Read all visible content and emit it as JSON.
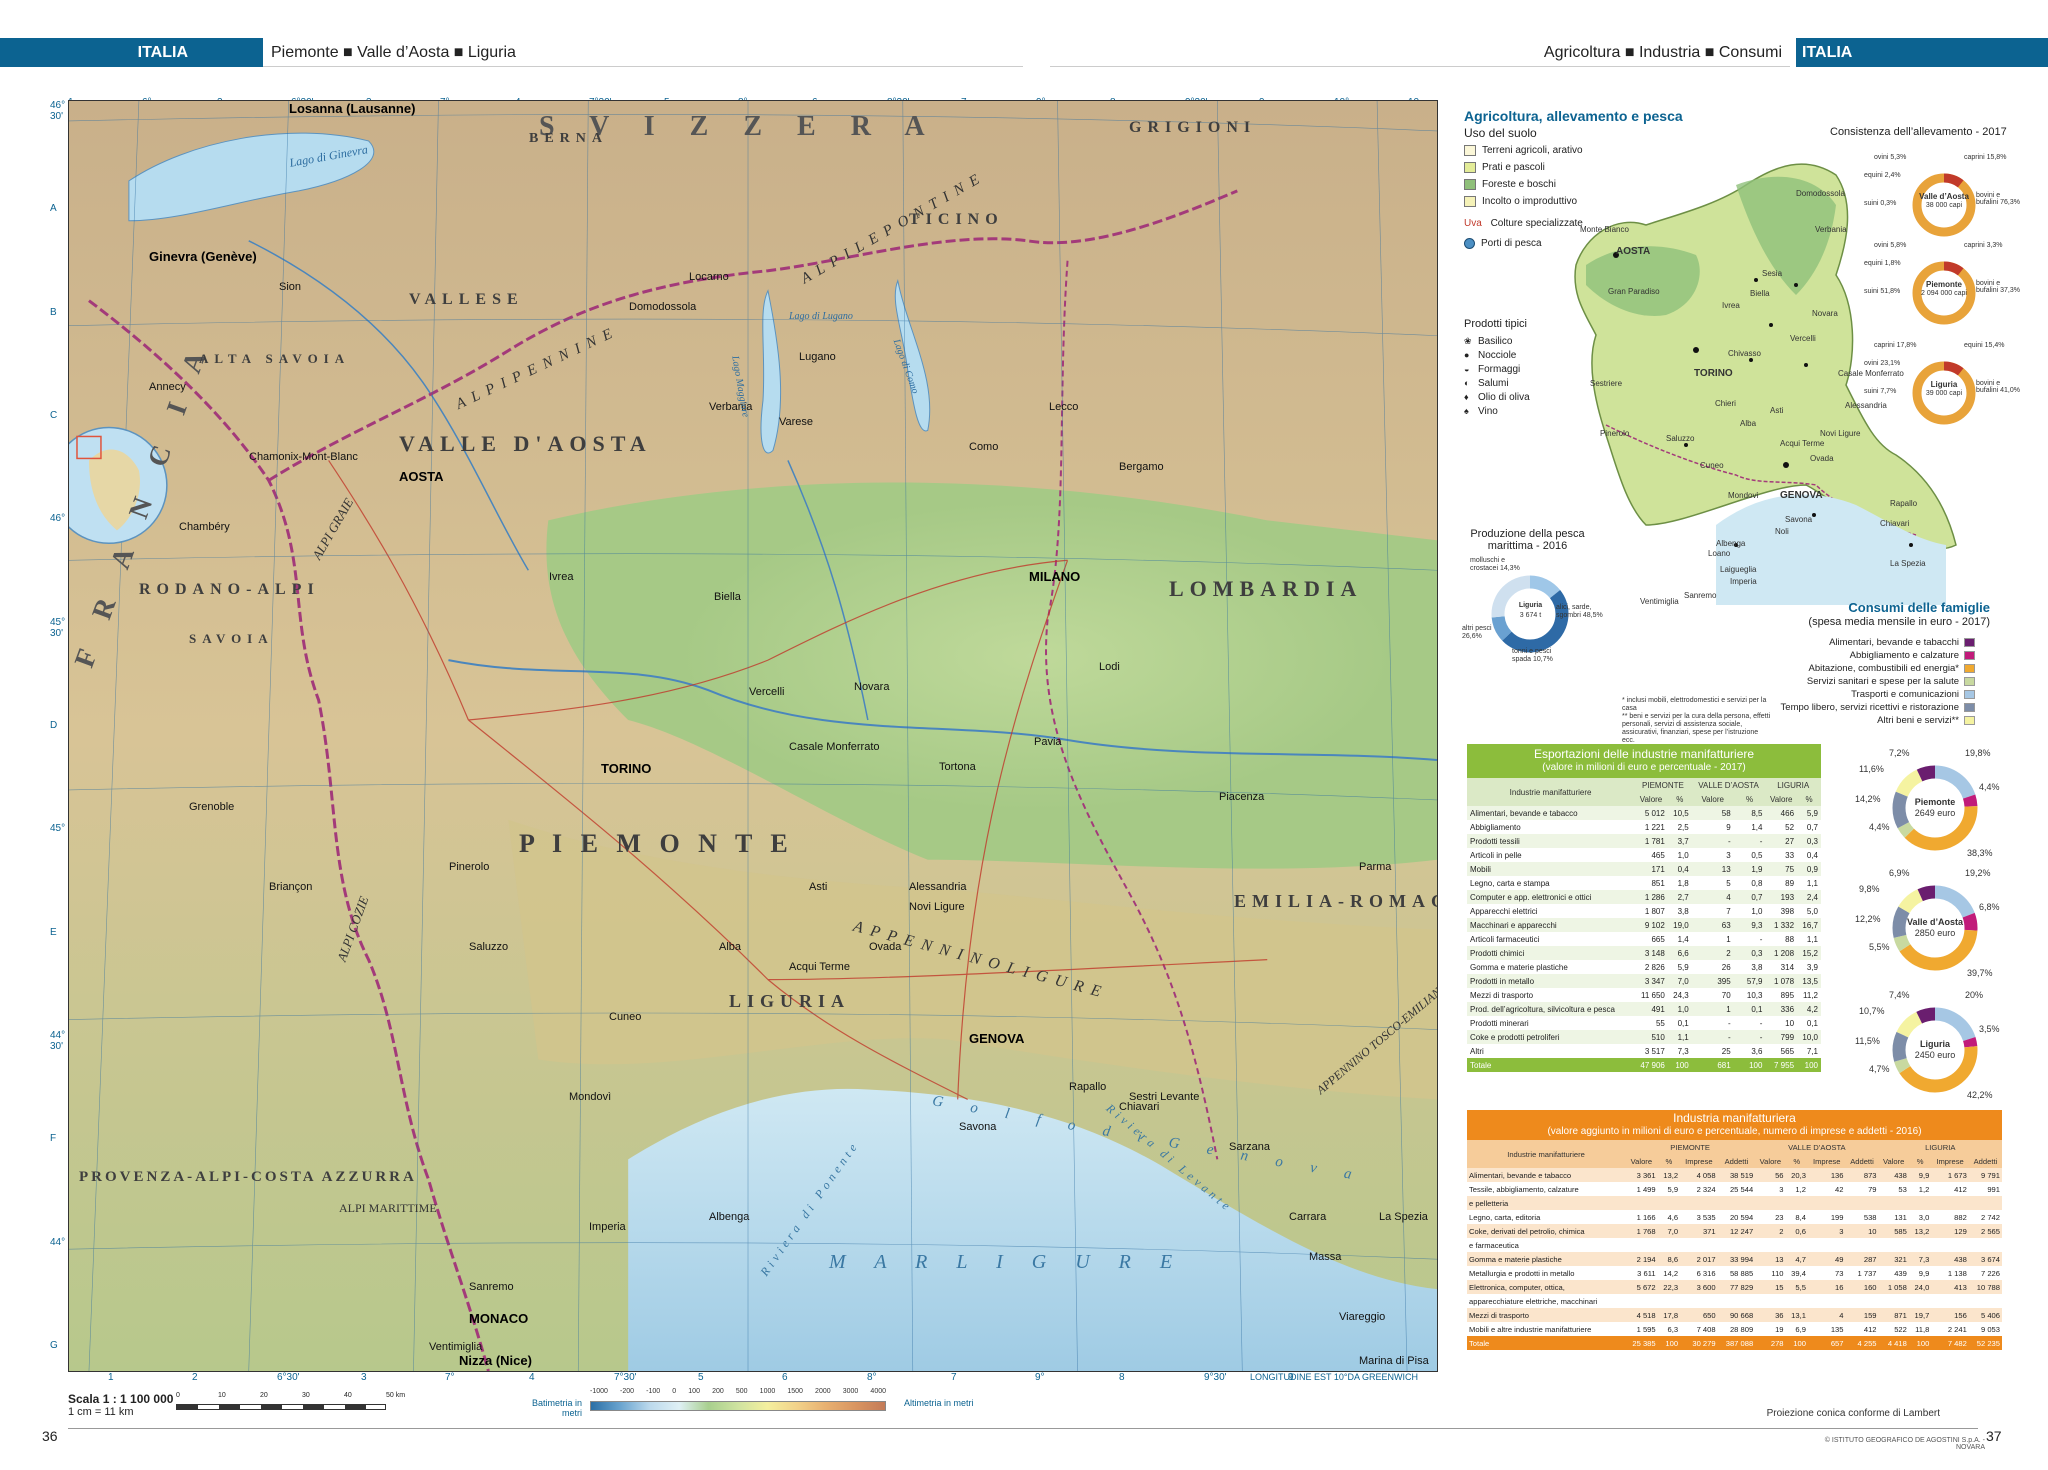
{
  "header": {
    "left_title": "ITALIA",
    "left_sub": "Piemonte ■ Valle d’Aosta ■ Liguria",
    "right_sub": "Agricoltura ■ Industria ■ Consumi",
    "right_title": "ITALIA"
  },
  "map": {
    "grid_top": [
      "1",
      "6°",
      "2",
      "6°30'",
      "3",
      "7°",
      "4",
      "7°30'",
      "5",
      "8°",
      "6",
      "8°30'",
      "7",
      "9°",
      "8",
      "9°30'",
      "9",
      "10°",
      "10"
    ],
    "grid_bottom": [
      "1",
      "2",
      "6°30'",
      "3",
      "7°",
      "4",
      "7°30'",
      "5",
      "6",
      "8°",
      "7",
      "9°",
      "8",
      "9°30'",
      "9"
    ],
    "grid_left": [
      "46° 30'",
      "A",
      "B",
      "C",
      "46°",
      "45° 30'",
      "D",
      "45°",
      "E",
      "44° 30'",
      "F",
      "44°",
      "G"
    ],
    "countries": [
      "S V I Z Z E R A",
      "F R A N C I A"
    ],
    "regions": [
      "VALLE D'AOSTA",
      "P I E M O N T E",
      "LOMBARDIA",
      "EMILIA-ROMAGNA",
      "LIGURIA",
      "RODANO-ALPI",
      "PROVENZA-ALPI-COSTA AZZURRA",
      "VALLESE",
      "TICINO",
      "GRIGIONI",
      "BERNA",
      "SAVOIA",
      "ALTA SAVOIA"
    ],
    "mountains": [
      "A L P I   P E N N I N E",
      "A L P I   L E P O N T I N E",
      "A P P E N N I N O   L I G U R E",
      "ALPI MARITTIME",
      "ALPI GRAIE",
      "ALPI COZIE",
      "APPENNINO TOSCO-EMILIANO"
    ],
    "sea": [
      "M A R   L I G U R E",
      "G o l f o   d i   G e n o v a",
      "Riviera di Ponente",
      "Riviera di Levante"
    ],
    "big_cities": [
      "TORINO",
      "MILANO",
      "GENOVA",
      "AOSTA",
      "Ginevra (Genève)",
      "Losanna (Lausanne)",
      "Nizza (Nice)",
      "MONACO"
    ],
    "cities": [
      "Novara",
      "Vercelli",
      "Biella",
      "Asti",
      "Alessandria",
      "Cuneo",
      "Savona",
      "La Spezia",
      "Imperia",
      "Pavia",
      "Varese",
      "Como",
      "Lecco",
      "Bergamo",
      "Lodi",
      "Piacenza",
      "Parma",
      "Sion",
      "Locarno",
      "Lugano",
      "Chiavari",
      "Sanremo",
      "Ventimiglia",
      "Chambéry",
      "Annecy",
      "Grenoble",
      "Briançon",
      "Chamonix-Mont-Blanc",
      "Domodossola",
      "Verbania",
      "Ivrea",
      "Pinerolo",
      "Saluzzo",
      "Mondovì",
      "Alba",
      "Casale Monferrato",
      "Tortona",
      "Novi Ligure",
      "Ovada",
      "Acqui Terme",
      "Rapallo",
      "Sestri Levante",
      "Albenga",
      "Sarzana",
      "Carrara",
      "Massa",
      "Viareggio"
    ],
    "lakes": [
      "Lago di Ginevra",
      "Lago Maggiore",
      "Lago di Como",
      "Lago di Lugano"
    ],
    "scale": {
      "label": "Scala 1 : 1 100 000",
      "sub": "1 cm = 11 km",
      "ticks": [
        "0",
        "10",
        "20",
        "30",
        "40",
        "50 km"
      ]
    },
    "bathy_label": "Batimetria in metri",
    "alti_label": "Altimetria in metri",
    "elev_ticks": [
      "-1000",
      "-200",
      "-100",
      "0",
      "100",
      "200",
      "500",
      "1000",
      "1500",
      "2000",
      "3000",
      "4000"
    ],
    "longitude_note": "LONGITUDINE EST 10°DA GREENWICH",
    "marina": "Marina di Pisa"
  },
  "agricoltura": {
    "title": "Agricoltura, allevamento e pesca",
    "uso_title": "Uso del suolo",
    "uso": [
      {
        "label": "Terreni agricoli, arativo",
        "color": "#fbf7d8"
      },
      {
        "label": "Prati e pascoli",
        "color": "#e3ec98"
      },
      {
        "label": "Foreste e boschi",
        "color": "#8fc07a"
      },
      {
        "label": "Incolto o improduttivo",
        "color": "#f5f2b8"
      }
    ],
    "uva": "Uva",
    "uva_label": "Colture specializzate",
    "porti": "Porti di pesca",
    "prodotti_title": "Prodotti tipici",
    "prodotti": [
      "Basilico",
      "Nocciole",
      "Formaggi",
      "Salumi",
      "Olio di oliva",
      "Vino"
    ],
    "alleva_title": "Consistenza dell’allevamento - 2017",
    "region_labels": [
      "AOSTA",
      "TORINO",
      "GENOVA",
      "Biella",
      "Novara",
      "Vercelli",
      "Asti",
      "Alessandria",
      "Cuneo",
      "Savona",
      "Imperia",
      "La Spezia",
      "Verbania",
      "Chivasso",
      "Mondovì",
      "Sanremo",
      "Ventimiglia",
      "Chiavari",
      "Rapallo",
      "Noli",
      "Albenga",
      "Laigueglia",
      "Loano",
      "Pinerolo",
      "Saluzzo",
      "Sestriere",
      "Ivrea",
      "Domodossola",
      "Alba",
      "Ovada",
      "Acqui Terme",
      "Novi Ligure",
      "Casale Monferrato",
      "Chieri",
      "Sesia",
      "Monte Bianco",
      "Gran Paradiso"
    ],
    "alleva_donuts": [
      {
        "name": "Valle d’Aosta",
        "value": "38 000 capi",
        "labels": [
          "ovini 5,3%",
          "caprini 15,8%",
          "equini 2,4%",
          "suini 0,3%",
          "bovini e bufalini 76,3%"
        ]
      },
      {
        "name": "Piemonte",
        "value": "2 094 000 capi",
        "labels": [
          "ovini 5,8%",
          "caprini 3,3%",
          "equini 1,8%",
          "suini 51,8%",
          "bovini e bufalini 37,3%"
        ]
      },
      {
        "name": "Liguria",
        "value": "39 000 capi",
        "labels": [
          "caprini 17,8%",
          "equini 15,4%",
          "ovini 23,1%",
          "suini 7,7%",
          "bovini e bufalini 41,0%"
        ]
      }
    ]
  },
  "pesca": {
    "title": "Produzione della pesca marittima - 2016",
    "center_name": "Liguria",
    "center_value": "3 674 t",
    "labels": [
      "molluschi e crostacei 14,3%",
      "alici, sarde, sgombri 48,5%",
      "tonni e pesci spada 10,7%",
      "altri pesci 26,6%"
    ],
    "values": [
      14.3,
      48.5,
      10.7,
      26.6
    ]
  },
  "consumi": {
    "title": "Consumi delle famiglie",
    "sub": "(spesa media mensile in euro - 2017)",
    "legend": [
      {
        "label": "Alimentari, bevande e tabacchi",
        "color": "#6a1e6f"
      },
      {
        "label": "Abbigliamento e calzature",
        "color": "#c11b7a"
      },
      {
        "label": "Abitazione, combustibili ed energia*",
        "color": "#f0a930"
      },
      {
        "label": "Servizi sanitari e spese per la salute",
        "color": "#c8d9a0"
      },
      {
        "label": "Trasporti e comunicazioni",
        "color": "#a6c7e4"
      },
      {
        "label": "Tempo libero, servizi ricettivi e ristorazione",
        "color": "#7d8da8"
      },
      {
        "label": "Altri beni e servizi**",
        "color": "#f5f3a1"
      }
    ],
    "notes": [
      "* inclusi mobili, elettrodomestici e servizi per la casa",
      "** beni e servizi per la cura della persona, effetti personali, servizi di assistenza sociale, assicurativi, finanziari, spese per l’istruzione ecc."
    ],
    "donuts": [
      {
        "name": "Piemonte",
        "value": "2649 euro",
        "pcts": [
          "7,2%",
          "19,8%",
          "11,6%",
          "4,4%",
          "14,2%",
          "4,4%",
          "38,3%"
        ],
        "values": [
          19.8,
          4.4,
          38.3,
          4.4,
          14.2,
          11.6,
          7.2
        ]
      },
      {
        "name": "Valle d’Aosta",
        "value": "2850 euro",
        "pcts": [
          "6,9%",
          "19,2%",
          "9,8%",
          "6,8%",
          "12,2%",
          "5,5%",
          "39,7%"
        ],
        "values": [
          19.2,
          6.8,
          39.7,
          5.5,
          12.2,
          9.8,
          6.9
        ]
      },
      {
        "name": "Liguria",
        "value": "2450 euro",
        "pcts": [
          "7,4%",
          "20%",
          "10,7%",
          "3,5%",
          "11,5%",
          "4,7%",
          "42,2%"
        ],
        "values": [
          20,
          3.5,
          42.2,
          4.7,
          11.5,
          10.7,
          7.4
        ]
      }
    ]
  },
  "export": {
    "title": "Esportazioni delle industrie manifatturiere",
    "sub": "(valore in milioni di euro e percentuale - 2017)",
    "headers": [
      "Industrie manifatturiere",
      "PIEMONTE",
      "VALLE D’AOSTA",
      "LIGURIA"
    ],
    "sub_headers": [
      "Valore",
      "%",
      "Valore",
      "%",
      "Valore",
      "%"
    ],
    "rows": [
      [
        "Alimentari, bevande e tabacco",
        "5 012",
        "10,5",
        "58",
        "8,5",
        "466",
        "5,9"
      ],
      [
        "Abbigliamento",
        "1 221",
        "2,5",
        "9",
        "1,4",
        "52",
        "0,7"
      ],
      [
        "Prodotti tessili",
        "1 781",
        "3,7",
        "-",
        "-",
        "27",
        "0,3"
      ],
      [
        "Articoli in pelle",
        "465",
        "1,0",
        "3",
        "0,5",
        "33",
        "0,4"
      ],
      [
        "Mobili",
        "171",
        "0,4",
        "13",
        "1,9",
        "75",
        "0,9"
      ],
      [
        "Legno, carta e stampa",
        "851",
        "1,8",
        "5",
        "0,8",
        "89",
        "1,1"
      ],
      [
        "Computer e app. elettronici e ottici",
        "1 286",
        "2,7",
        "4",
        "0,7",
        "193",
        "2,4"
      ],
      [
        "Apparecchi elettrici",
        "1 807",
        "3,8",
        "7",
        "1,0",
        "398",
        "5,0"
      ],
      [
        "Macchinari e apparecchi",
        "9 102",
        "19,0",
        "63",
        "9,3",
        "1 332",
        "16,7"
      ],
      [
        "Articoli farmaceutici",
        "665",
        "1,4",
        "1",
        "-",
        "88",
        "1,1"
      ],
      [
        "Prodotti chimici",
        "3 148",
        "6,6",
        "2",
        "0,3",
        "1 208",
        "15,2"
      ],
      [
        "Gomma e materie plastiche",
        "2 826",
        "5,9",
        "26",
        "3,8",
        "314",
        "3,9"
      ],
      [
        "Prodotti in metallo",
        "3 347",
        "7,0",
        "395",
        "57,9",
        "1 078",
        "13,5"
      ],
      [
        "Mezzi di trasporto",
        "11 650",
        "24,3",
        "70",
        "10,3",
        "895",
        "11,2"
      ],
      [
        "Prod. dell’agricoltura, silvicoltura e pesca",
        "491",
        "1,0",
        "1",
        "0,1",
        "336",
        "4,2"
      ],
      [
        "Prodotti minerari",
        "55",
        "0,1",
        "-",
        "-",
        "10",
        "0,1"
      ],
      [
        "Coke e prodotti petroliferi",
        "510",
        "1,1",
        "-",
        "-",
        "799",
        "10,0"
      ],
      [
        "Altri",
        "3 517",
        "7,3",
        "25",
        "3,6",
        "565",
        "7,1"
      ]
    ],
    "total": [
      "Totale",
      "47 906",
      "100",
      "681",
      "100",
      "7 955",
      "100"
    ]
  },
  "industria": {
    "title": "Industria manifatturiera",
    "sub": "(valore aggiunto in milioni di euro e percentuale, numero di imprese e addetti - 2016)",
    "headers": [
      "Industrie manifatturiere",
      "PIEMONTE",
      "VALLE D’AOSTA",
      "LIGURIA"
    ],
    "sub_headers": [
      "Valore",
      "%",
      "Imprese",
      "Addetti",
      "Valore",
      "%",
      "Imprese",
      "Addetti",
      "Valore",
      "%",
      "Imprese",
      "Addetti"
    ],
    "rows": [
      [
        "Alimentari, bevande e tabacco",
        "3 361",
        "13,2",
        "4 058",
        "38 519",
        "56",
        "20,3",
        "136",
        "873",
        "438",
        "9,9",
        "1 673",
        "9 791"
      ],
      [
        "Tessile, abbigliamento, calzature",
        "1 499",
        "5,9",
        "2 324",
        "25 544",
        "3",
        "1,2",
        "42",
        "79",
        "53",
        "1,2",
        "412",
        "991"
      ],
      [
        "e pelletteria",
        "",
        "",
        "",
        "",
        "",
        "",
        "",
        "",
        "",
        "",
        "",
        ""
      ],
      [
        "Legno, carta, editoria",
        "1 166",
        "4,6",
        "3 535",
        "20 594",
        "23",
        "8,4",
        "199",
        "538",
        "131",
        "3,0",
        "882",
        "2 742"
      ],
      [
        "Coke, derivati del petrolio, chimica",
        "1 768",
        "7,0",
        "371",
        "12 247",
        "2",
        "0,6",
        "3",
        "10",
        "585",
        "13,2",
        "129",
        "2 565"
      ],
      [
        "e farmaceutica",
        "",
        "",
        "",
        "",
        "",
        "",
        "",
        "",
        "",
        "",
        "",
        ""
      ],
      [
        "Gomma e materie plastiche",
        "2 194",
        "8,6",
        "2 017",
        "33 994",
        "13",
        "4,7",
        "49",
        "287",
        "321",
        "7,3",
        "438",
        "3 674"
      ],
      [
        "Metallurgia e prodotti in metallo",
        "3 611",
        "14,2",
        "6 316",
        "58 885",
        "110",
        "39,4",
        "73",
        "1 737",
        "439",
        "9,9",
        "1 138",
        "7 226"
      ],
      [
        "Elettronica, computer, ottica,",
        "5 672",
        "22,3",
        "3 600",
        "77 829",
        "15",
        "5,5",
        "16",
        "160",
        "1 058",
        "24,0",
        "413",
        "10 788"
      ],
      [
        "apparecchiature elettriche, macchinari",
        "",
        "",
        "",
        "",
        "",
        "",
        "",
        "",
        "",
        "",
        "",
        ""
      ],
      [
        "Mezzi di trasporto",
        "4 518",
        "17,8",
        "650",
        "90 668",
        "36",
        "13,1",
        "4",
        "159",
        "871",
        "19,7",
        "156",
        "5 406"
      ],
      [
        "Mobili e altre industrie manifatturiere",
        "1 595",
        "6,3",
        "7 408",
        "28 809",
        "19",
        "6,9",
        "135",
        "412",
        "522",
        "11,8",
        "2 241",
        "9 053"
      ]
    ],
    "total": [
      "Totale",
      "25 385",
      "100",
      "30 279",
      "387 088",
      "278",
      "100",
      "657",
      "4 255",
      "4 418",
      "100",
      "7 482",
      "52 235"
    ]
  },
  "footer": {
    "page_left": "36",
    "page_right": "37",
    "projection": "Proiezione conica conforme di Lambert",
    "copyright": "© ISTITUTO GEOGRAFICO DE AGOSTINI S.p.A. - NOVARA"
  }
}
